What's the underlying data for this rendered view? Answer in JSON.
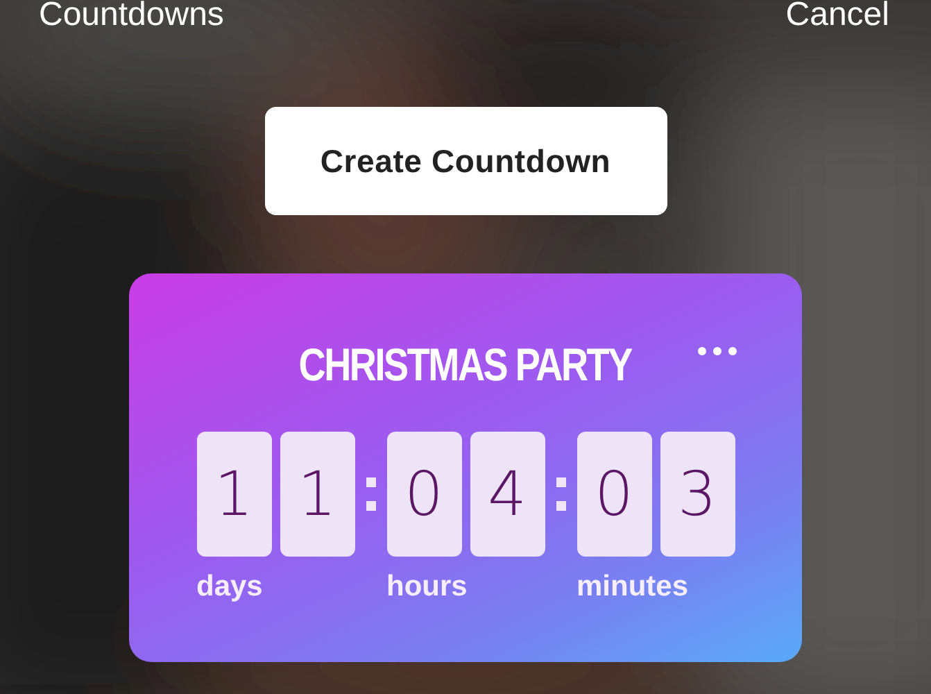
{
  "header": {
    "title": "Countdowns",
    "cancel": "Cancel"
  },
  "create_button": "Create Countdown",
  "countdown": {
    "title": "CHRISTMAS PARTY",
    "units": [
      {
        "digits": [
          "1",
          "1"
        ],
        "label": "days"
      },
      {
        "digits": [
          "0",
          "4"
        ],
        "label": "hours"
      },
      {
        "digits": [
          "0",
          "3"
        ],
        "label": "minutes"
      }
    ]
  }
}
